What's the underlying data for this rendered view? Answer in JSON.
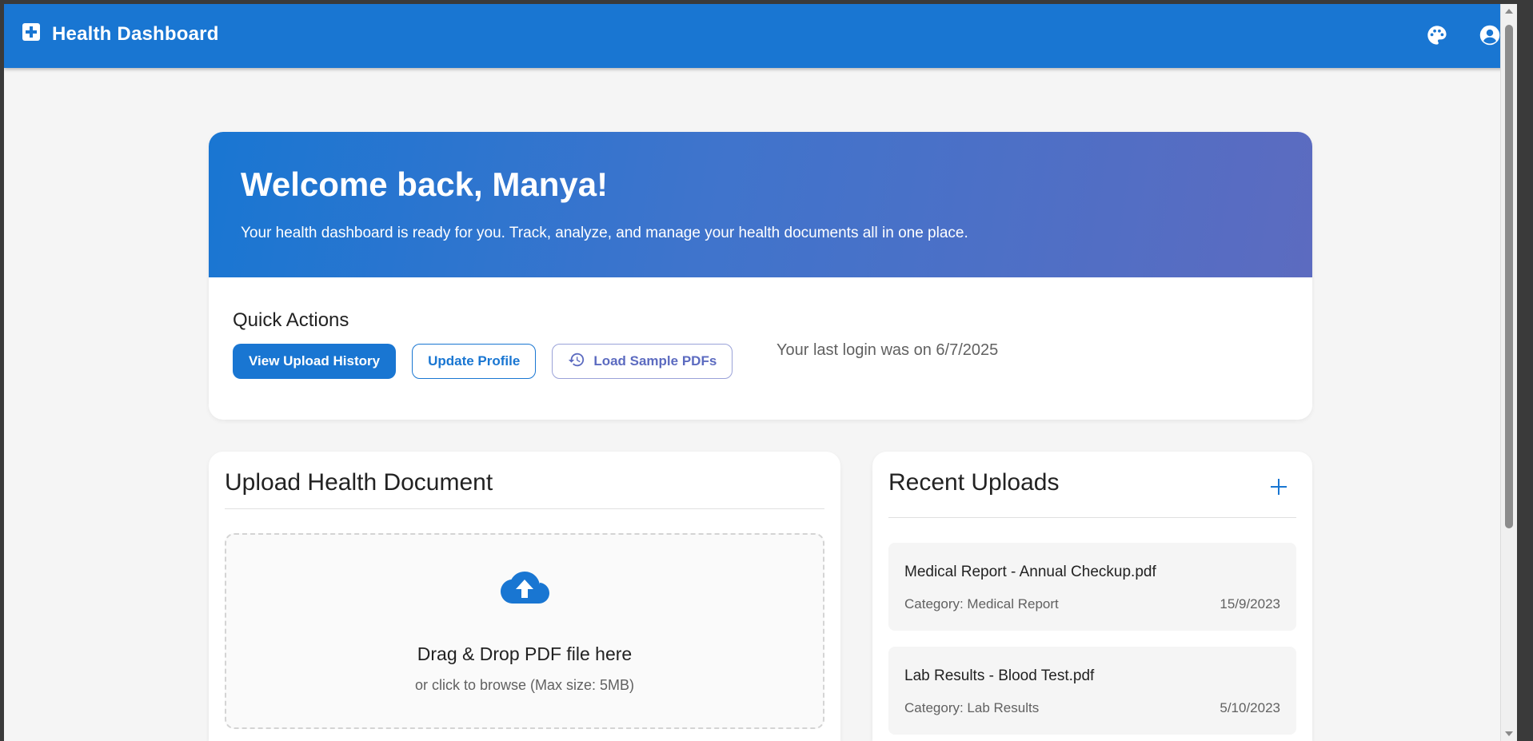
{
  "colors": {
    "primary": "#1976d2",
    "indigo": "#5c6bc0",
    "background": "#f5f5f5",
    "text_secondary": "#616161"
  },
  "appbar": {
    "logo_icon": "medical-plus-icon",
    "title": "Health Dashboard",
    "theme_icon": "palette-icon",
    "account_icon": "account-circle-icon"
  },
  "welcome": {
    "title": "Welcome back, Manya!",
    "subtitle": "Your health dashboard is ready for you. Track, analyze, and manage your health documents all in one place."
  },
  "quick_actions": {
    "title": "Quick Actions",
    "view_history_label": "View Upload History",
    "update_profile_label": "Update Profile",
    "load_samples_label": "Load Sample PDFs",
    "load_samples_icon": "history-icon",
    "last_login": "Your last login was on 6/7/2025"
  },
  "upload": {
    "title": "Upload Health Document",
    "icon": "cloud-upload-icon",
    "drop_title": "Drag & Drop PDF file here",
    "drop_sub": "or click to browse (Max size: 5MB)"
  },
  "recent": {
    "title": "Recent Uploads",
    "add_icon": "plus-icon",
    "items": [
      {
        "name": "Medical Report - Annual Checkup.pdf",
        "category": "Category: Medical Report",
        "date": "15/9/2023"
      },
      {
        "name": "Lab Results - Blood Test.pdf",
        "category": "Category: Lab Results",
        "date": "5/10/2023"
      }
    ]
  }
}
